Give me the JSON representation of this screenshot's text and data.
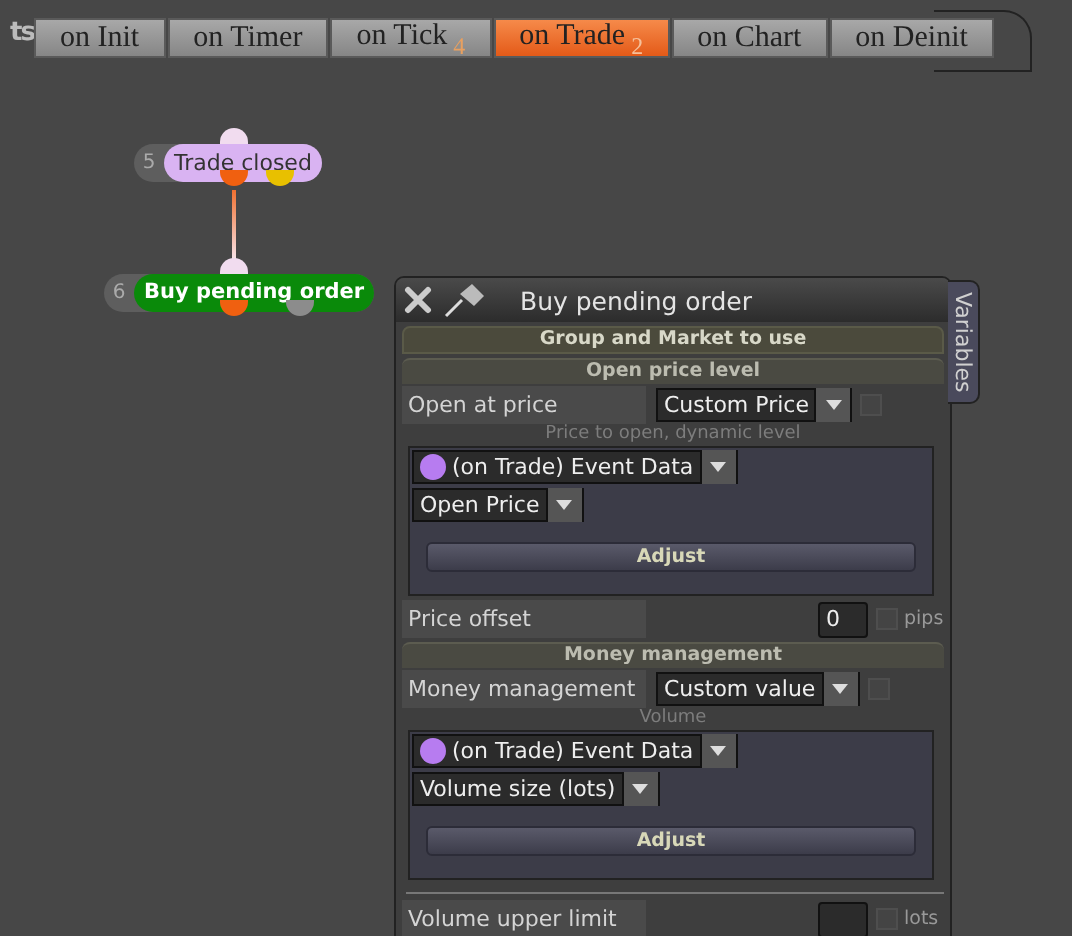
{
  "tabs_label_fragment": "ts",
  "tabs": [
    {
      "label": "on Init",
      "selected": false
    },
    {
      "label": "on Timer",
      "selected": false
    },
    {
      "label": "on Tick",
      "badge": "4",
      "selected": false
    },
    {
      "label": "on Trade",
      "badge": "2",
      "selected": true
    },
    {
      "label": "on Chart",
      "selected": false
    },
    {
      "label": "on Deinit",
      "selected": false
    }
  ],
  "nodes": [
    {
      "number": "5",
      "label": "Trade closed",
      "color": "#d9b3f2",
      "outputs": [
        {
          "color": "#f06010"
        },
        {
          "color": "#e8c000"
        }
      ]
    },
    {
      "number": "6",
      "label": "Buy pending order",
      "color": "#0a8a0a",
      "outputs": [
        {
          "color": "#f06010"
        },
        {
          "color": "#8c8c8c"
        }
      ]
    }
  ],
  "panel": {
    "title": "Buy pending order",
    "side_tab": "Variables",
    "rows": [
      {
        "kind": "header",
        "text": "Group and Market to use"
      },
      {
        "kind": "section",
        "text": "Open price level"
      },
      {
        "kind": "select",
        "label": "Open at price",
        "value": "Custom Price",
        "checked": false
      },
      {
        "kind": "hint",
        "text": "Price to open, dynamic level"
      },
      {
        "kind": "source",
        "color": "#b77cf0",
        "source": "(on Trade) Event Data",
        "field": "Open Price",
        "button": "Adjust"
      },
      {
        "kind": "input",
        "label": "Price offset",
        "value": "0",
        "checked": false,
        "unit": "pips"
      },
      {
        "kind": "section",
        "text": "Money management"
      },
      {
        "kind": "select",
        "label": "Money management",
        "value": "Custom value",
        "checked": false
      },
      {
        "kind": "hint",
        "text": "Volume"
      },
      {
        "kind": "source",
        "color": "#b77cf0",
        "source": "(on Trade) Event Data",
        "field": "Volume size (lots)",
        "button": "Adjust"
      },
      {
        "kind": "divider"
      },
      {
        "kind": "input",
        "label": "Volume upper limit",
        "checked": false,
        "unit": "lots"
      }
    ]
  }
}
